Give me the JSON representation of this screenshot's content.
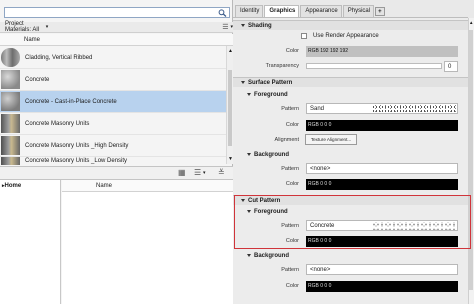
{
  "left": {
    "search": {
      "placeholder": ""
    },
    "filter_label": "Project Materials: All",
    "list_header": "Name",
    "materials": [
      {
        "name": "Cladding, Vertical Ribbed",
        "selected": false
      },
      {
        "name": "Concrete",
        "selected": false
      },
      {
        "name": "Concrete - Cast-in-Place Concrete",
        "selected": true
      },
      {
        "name": "Concrete Masonry Units",
        "selected": false
      },
      {
        "name": "Concrete Masonry Units _High Density",
        "selected": false
      },
      {
        "name": "Concrete Masonry Units _Low Density",
        "selected": false
      }
    ],
    "tree_home": "Home",
    "lower_header": "Name"
  },
  "right": {
    "tabs": [
      "Identity",
      "Graphics",
      "Appearance",
      "Physical"
    ],
    "active_tab": "Graphics",
    "add_tab": "+",
    "shading": {
      "title": "Shading",
      "use_render": "Use Render Appearance",
      "color_label": "Color",
      "color_value": "RGB 192 192 192",
      "transparency_label": "Transparency",
      "transparency_value": "0"
    },
    "surface_pattern": {
      "title": "Surface Pattern",
      "foreground": {
        "title": "Foreground",
        "pattern_label": "Pattern",
        "pattern_value": "Sand",
        "color_label": "Color",
        "color_value": "RGB 0 0 0",
        "alignment_label": "Alignment",
        "alignment_button": "Texture Alignment..."
      },
      "background": {
        "title": "Background",
        "pattern_label": "Pattern",
        "pattern_value": "<none>",
        "color_label": "Color",
        "color_value": "RGB 0 0 0"
      }
    },
    "cut_pattern": {
      "title": "Cut Pattern",
      "foreground": {
        "title": "Foreground",
        "pattern_label": "Pattern",
        "pattern_value": "Concrete",
        "color_label": "Color",
        "color_value": "RGB 0 0 0"
      },
      "background": {
        "title": "Background",
        "pattern_label": "Pattern",
        "pattern_value": "<none>",
        "color_label": "Color",
        "color_value": "RGB 0 0 0"
      }
    }
  },
  "colors": {
    "selection": "#b8d2ee",
    "highlight_border": "#d0343a",
    "shading_swatch": "#c0c0c0",
    "black_swatch": "#000000"
  }
}
